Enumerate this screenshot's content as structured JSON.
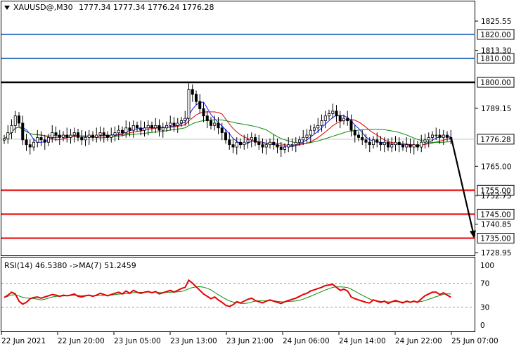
{
  "window": {
    "symbol": "XAUUSD@,M30",
    "ohlc": "1777.34 1777.34 1776.24 1776.28",
    "collapse_icon": "triangle-down-icon"
  },
  "chart_data": [
    {
      "type": "candlestick",
      "title": "XAUUSD@,M30",
      "ylim": [
        1724,
        1835
      ],
      "y_ticks": [
        "1825.55",
        "1813.30",
        "1789.15",
        "1765.00",
        "1752.75",
        "1740.85",
        "1728.95"
      ],
      "last_price": 1776.28,
      "last_price_label": "1776.28",
      "x_ticks": [
        "22 Jun 2021",
        "22 Jun 20:00",
        "23 Jun 05:00",
        "23 Jun 13:00",
        "23 Jun 21:00",
        "24 Jun 06:00",
        "24 Jun 14:00",
        "24 Jun 22:00",
        "25 Jun 07:00"
      ],
      "levels": [
        {
          "value": 1820.0,
          "label": "1820.00",
          "color": "#3a78c2"
        },
        {
          "value": 1810.0,
          "label": "1810.00",
          "color": "#3a78c2"
        },
        {
          "value": 1800.0,
          "label": "1800.00",
          "color": "#000000"
        },
        {
          "value": 1755.0,
          "label": "1755.00",
          "color": "#e60000"
        },
        {
          "value": 1745.0,
          "label": "1745.00",
          "color": "#e60000"
        },
        {
          "value": 1735.0,
          "label": "1735.00",
          "color": "#e60000"
        }
      ],
      "closes": [
        1776.5,
        1779,
        1782,
        1786,
        1783,
        1776,
        1774,
        1773,
        1775,
        1777,
        1776,
        1775,
        1777,
        1779,
        1778,
        1777,
        1778,
        1777,
        1778,
        1779,
        1777,
        1776,
        1777,
        1778,
        1777,
        1778,
        1779,
        1778,
        1777,
        1778,
        1779,
        1780,
        1779,
        1781,
        1780,
        1782,
        1781,
        1780,
        1781,
        1782,
        1781,
        1782,
        1780,
        1781,
        1782,
        1783,
        1782,
        1783,
        1784,
        1785,
        1797,
        1795,
        1792,
        1789,
        1786,
        1784,
        1782,
        1783,
        1781,
        1779,
        1776,
        1774,
        1773,
        1775,
        1774,
        1775,
        1776,
        1777,
        1775,
        1774,
        1773,
        1774,
        1775,
        1774,
        1773,
        1772,
        1773,
        1774,
        1774,
        1775,
        1776,
        1777,
        1778,
        1780,
        1781,
        1782,
        1784,
        1786,
        1787,
        1788,
        1786,
        1784,
        1785,
        1784,
        1780,
        1778,
        1777,
        1776,
        1775,
        1774,
        1776,
        1775,
        1774,
        1775,
        1773,
        1774,
        1775,
        1774,
        1773,
        1774,
        1773,
        1774,
        1773,
        1775,
        1776,
        1777,
        1778,
        1778,
        1777,
        1778,
        1777,
        1776.28
      ],
      "projection": {
        "from_label": "1776.28",
        "to_label": "1735.00"
      },
      "series": [
        {
          "name": "MA fast",
          "color": "#1a1aff"
        },
        {
          "name": "MA mid",
          "color": "#e60000"
        },
        {
          "name": "MA slow",
          "color": "#0a8a0a"
        }
      ]
    },
    {
      "type": "line",
      "title": "RSI(14) 46.5380 ->MA(7) 51.2459",
      "ylim": [
        0,
        100
      ],
      "y_ticks": [
        "100",
        "70",
        "30",
        "0"
      ],
      "levels": [
        70,
        30
      ],
      "rsi": [
        46,
        50,
        55,
        52,
        40,
        35,
        38,
        44,
        46,
        47,
        45,
        47,
        49,
        51,
        50,
        48,
        50,
        49,
        50,
        52,
        48,
        47,
        49,
        50,
        48,
        50,
        53,
        51,
        49,
        51,
        53,
        55,
        52,
        57,
        53,
        58,
        55,
        53,
        55,
        56,
        54,
        56,
        52,
        54,
        56,
        58,
        55,
        58,
        61,
        63,
        75,
        70,
        64,
        58,
        52,
        48,
        44,
        47,
        42,
        38,
        33,
        31,
        34,
        39,
        37,
        40,
        43,
        45,
        41,
        39,
        37,
        40,
        42,
        40,
        38,
        36,
        39,
        41,
        43,
        45,
        48,
        51,
        53,
        57,
        59,
        61,
        63,
        66,
        67,
        68,
        63,
        58,
        60,
        57,
        47,
        44,
        42,
        40,
        38,
        37,
        42,
        40,
        38,
        40,
        36,
        39,
        41,
        39,
        37,
        40,
        38,
        40,
        38,
        44,
        49,
        52,
        55,
        55,
        51,
        54,
        50,
        46.5
      ],
      "rsi_color": "#e60000",
      "ma_color": "#0a8a0a"
    }
  ]
}
